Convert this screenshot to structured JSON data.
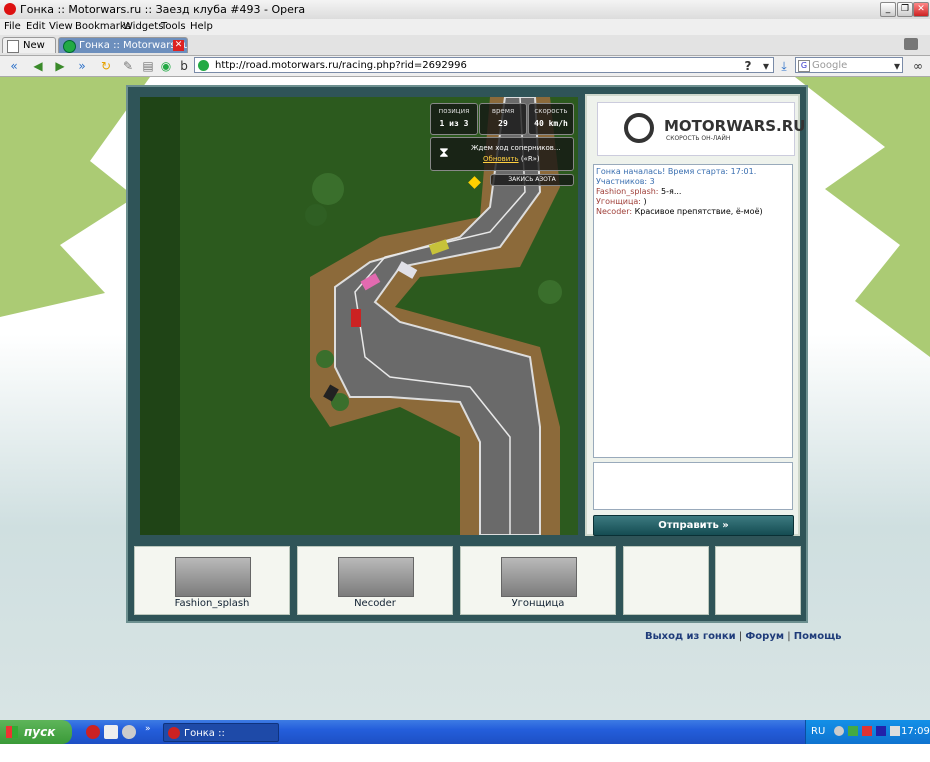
{
  "window": {
    "title": "Гонка :: Motorwars.ru :: Заезд клуба #493 - Opera"
  },
  "menu": [
    "File",
    "Edit",
    "View",
    "Bookmarks",
    "Widgets",
    "Tools",
    "Help"
  ],
  "tabs": [
    {
      "label": "New tab"
    },
    {
      "label": "Гонка :: Motorwars.ru ::..."
    }
  ],
  "address": {
    "url": "http://road.motorwars.ru/racing.php?rid=2692996",
    "search_placeholder": "Google"
  },
  "hud": {
    "position_label": "позиция",
    "position_value": "1 из 3",
    "time_label": "время",
    "time_value": "29",
    "speed_label": "скорость",
    "speed_value": "40 km/h",
    "wait_text": "Ждем ход соперников...",
    "refresh_link": "Обновить",
    "refresh_key": "(«R»)",
    "nitro_label": "ЗАКИСЬ АЗОТА"
  },
  "logo": {
    "name": "MOTORWARS.RU",
    "tagline": "СКОРОСТЬ ОН-ЛАЙН"
  },
  "chat": {
    "system_message": "Гонка началась! Время старта: 17:01. Участников: 3",
    "messages": [
      {
        "user": "Fashion_splash:",
        "text": " 5-я..."
      },
      {
        "user": "Угонщица:",
        "text": " )"
      },
      {
        "user": "Necoder:",
        "text": " Красивое препятствие, ё-моё)"
      }
    ],
    "send_label": "Отправить »"
  },
  "players": [
    "Fashion_splash",
    "Necoder",
    "Угонщица"
  ],
  "footer": {
    "exit": "Выход из гонки",
    "forum": "Форум",
    "help": "Помощь",
    "sep": "|"
  },
  "taskbar": {
    "start_label": "пуск",
    "task_label": "Гонка :: Motorwars.r...",
    "lang": "RU",
    "clock": "17:09"
  }
}
